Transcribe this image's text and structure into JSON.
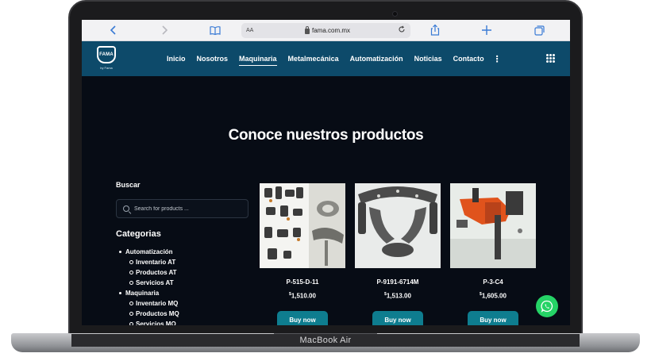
{
  "browser": {
    "address_aa": "AA",
    "url": "fama.com.mx"
  },
  "nav": {
    "logo_text": "FAMA",
    "logo_sub": "by Fama",
    "items": [
      {
        "label": "Inicio"
      },
      {
        "label": "Nosotros"
      },
      {
        "label": "Maquinaria"
      },
      {
        "label": "Metalmecánica"
      },
      {
        "label": "Automatización"
      },
      {
        "label": "Noticias"
      },
      {
        "label": "Contacto"
      }
    ],
    "active_index": 2,
    "more": "⋮"
  },
  "main": {
    "title": "Conoce nuestros productos"
  },
  "sidebar": {
    "search_heading": "Buscar",
    "search_placeholder": "Search for products ...",
    "categories_heading": "Categorias",
    "categories": [
      {
        "label": "Automatización",
        "level": 0
      },
      {
        "label": "Inventario AT",
        "level": 1
      },
      {
        "label": "Productos AT",
        "level": 1
      },
      {
        "label": "Servicios AT",
        "level": 1
      },
      {
        "label": "Maquinaria",
        "level": 0
      },
      {
        "label": "Inventario MQ",
        "level": 1
      },
      {
        "label": "Productos MQ",
        "level": 1
      },
      {
        "label": "Servicios MQ",
        "level": 1
      }
    ]
  },
  "products": [
    {
      "name": "P-515-D-11",
      "currency": "$",
      "price": "1,510.00",
      "button": "Buy now"
    },
    {
      "name": "P-9191-6714M",
      "currency": "$",
      "price": "1,513.00",
      "button": "Buy now"
    },
    {
      "name": "P-3-C4",
      "currency": "$",
      "price": "1,605.00",
      "button": "Buy now"
    }
  ],
  "device": {
    "model": "MacBook Air"
  },
  "colors": {
    "nav_bg": "#0d4a6a",
    "page_bg": "#070c15",
    "button": "#0e7d8f",
    "whatsapp": "#25d366"
  }
}
